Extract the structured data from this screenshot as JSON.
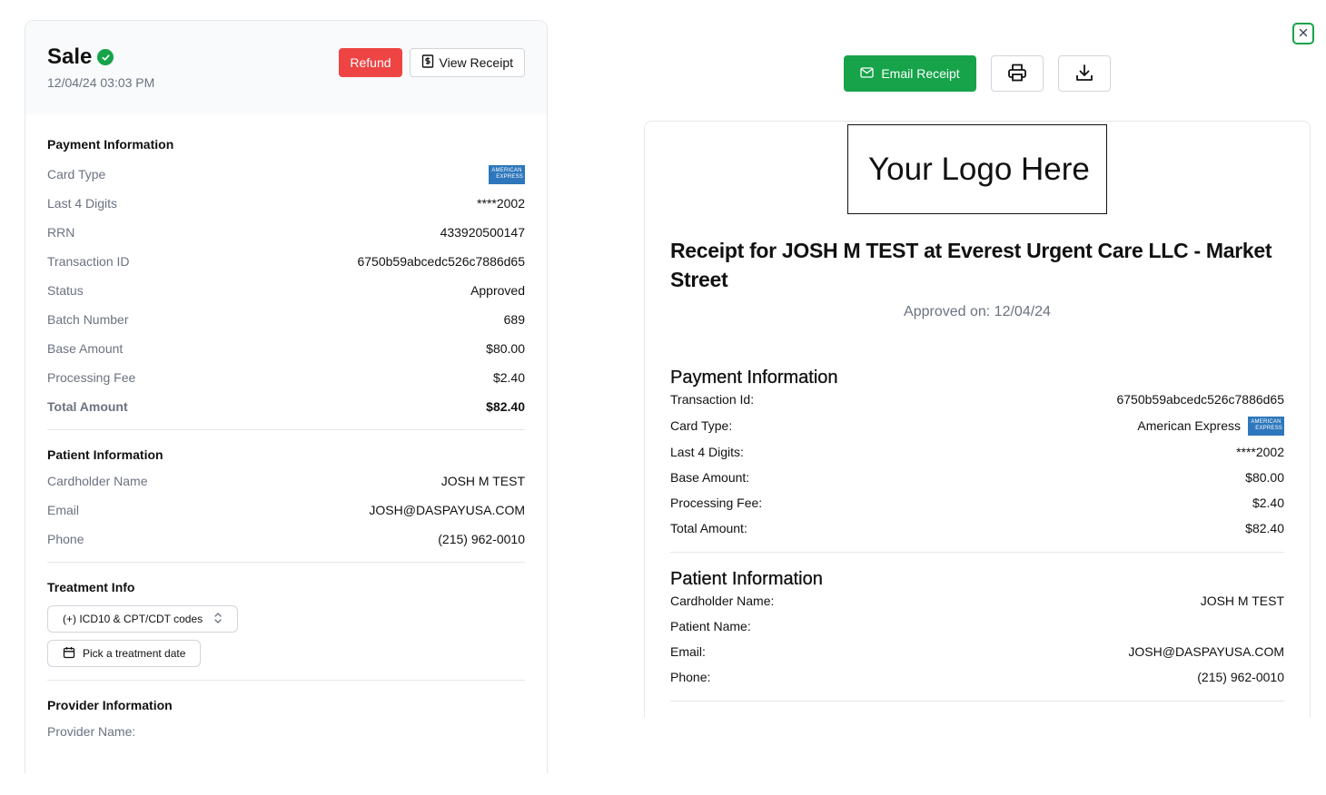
{
  "sale": {
    "title": "Sale",
    "date": "12/04/24 03:03 PM",
    "refund_label": "Refund",
    "view_receipt_label": "View Receipt"
  },
  "payment_info": {
    "title": "Payment Information",
    "card_type_label": "Card Type",
    "card_logo": [
      "AMERICAN",
      "EXPRESS"
    ],
    "rows": [
      {
        "label": "Last 4 Digits",
        "value": "****2002"
      },
      {
        "label": "RRN",
        "value": "433920500147"
      },
      {
        "label": "Transaction ID",
        "value": "6750b59abcedc526c7886d65"
      },
      {
        "label": "Status",
        "value": "Approved"
      },
      {
        "label": "Batch Number",
        "value": "689"
      },
      {
        "label": "Base Amount",
        "value": "$80.00"
      },
      {
        "label": "Processing Fee",
        "value": "$2.40"
      }
    ],
    "total_label": "Total Amount",
    "total_value": "$82.40"
  },
  "patient_info": {
    "title": "Patient Information",
    "rows": [
      {
        "label": "Cardholder Name",
        "value": "JOSH M TEST"
      },
      {
        "label": "Email",
        "value": "JOSH@DASPAYUSA.COM"
      },
      {
        "label": "Phone",
        "value": "(215) 962-0010"
      }
    ]
  },
  "treatment_info": {
    "title": "Treatment Info",
    "codes_button": "(+) ICD10 & CPT/CDT codes",
    "date_button": "Pick a treatment date"
  },
  "provider_info": {
    "title": "Provider Information",
    "provider_name_label": "Provider Name:"
  },
  "receipt_actions": {
    "email_label": "Email Receipt",
    "print_icon": "printer-icon",
    "download_icon": "download-icon"
  },
  "receipt": {
    "logo_text": "Your Logo Here",
    "title": "Receipt for JOSH M TEST at Everest Urgent Care LLC - Market Street",
    "approved": "Approved on: 12/04/24",
    "payment_title": "Payment Information",
    "payment_rows": [
      {
        "label": "Transaction Id:",
        "value": "6750b59abcedc526c7886d65"
      },
      {
        "label": "Card Type:",
        "value": "American Express"
      },
      {
        "label": "Last 4 Digits:",
        "value": "****2002"
      },
      {
        "label": "Base Amount:",
        "value": "$80.00"
      },
      {
        "label": "Processing Fee:",
        "value": "$2.40"
      },
      {
        "label": "Total Amount:",
        "value": "$82.40"
      }
    ],
    "patient_title": "Patient Information",
    "patient_rows": [
      {
        "label": "Cardholder Name:",
        "value": "JOSH M TEST"
      },
      {
        "label": "Patient Name:",
        "value": ""
      },
      {
        "label": "Email:",
        "value": "JOSH@DASPAYUSA.COM"
      },
      {
        "label": "Phone:",
        "value": "(215) 962-0010"
      }
    ]
  },
  "colors": {
    "accent_green": "#16a34a",
    "refund_red": "#ef4444",
    "amex_blue": "#2e77bc"
  }
}
